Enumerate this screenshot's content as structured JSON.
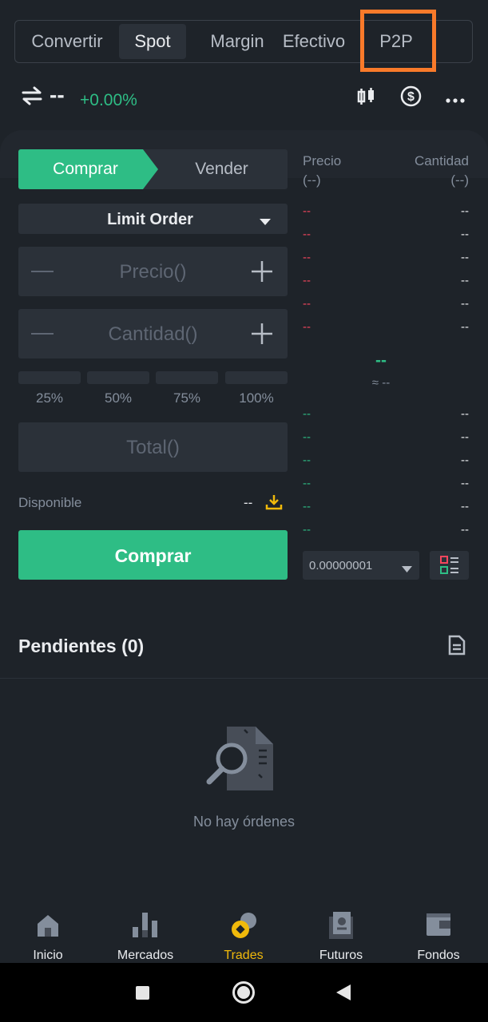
{
  "tabs": [
    "Convertir",
    "Spot",
    "Margin",
    "Efectivo",
    "P2P"
  ],
  "pair": {
    "name": "--",
    "change": "+0.00%"
  },
  "form": {
    "buy_tab": "Comprar",
    "sell_tab": "Vender",
    "order_type": "Limit Order",
    "price_placeholder": "Precio()",
    "amount_placeholder": "Cantidad()",
    "percents": [
      "25%",
      "50%",
      "75%",
      "100%"
    ],
    "total_placeholder": "Total()",
    "available_label": "Disponible",
    "available_value": "--",
    "buy_button": "Comprar"
  },
  "orderbook": {
    "price_header": "Precio",
    "price_unit": "(--)",
    "qty_header": "Cantidad",
    "qty_unit": "(--)",
    "asks": [
      [
        "--",
        "--"
      ],
      [
        "--",
        "--"
      ],
      [
        "--",
        "--"
      ],
      [
        "--",
        "--"
      ],
      [
        "--",
        "--"
      ],
      [
        "--",
        "--"
      ]
    ],
    "mid_price": "--",
    "mid_approx": "≈ --",
    "bids": [
      [
        "--",
        "--"
      ],
      [
        "--",
        "--"
      ],
      [
        "--",
        "--"
      ],
      [
        "--",
        "--"
      ],
      [
        "--",
        "--"
      ],
      [
        "--",
        "--"
      ]
    ],
    "precision": "0.00000001"
  },
  "pending": {
    "title": "Pendientes (0)",
    "empty": "No hay órdenes"
  },
  "bottom_nav": [
    "Inicio",
    "Mercados",
    "Trades",
    "Futuros",
    "Fondos"
  ],
  "colors": {
    "buy": "#2ebd85",
    "sell": "#f6465d",
    "accent": "#f0b90b",
    "highlight": "#f97a2a"
  }
}
